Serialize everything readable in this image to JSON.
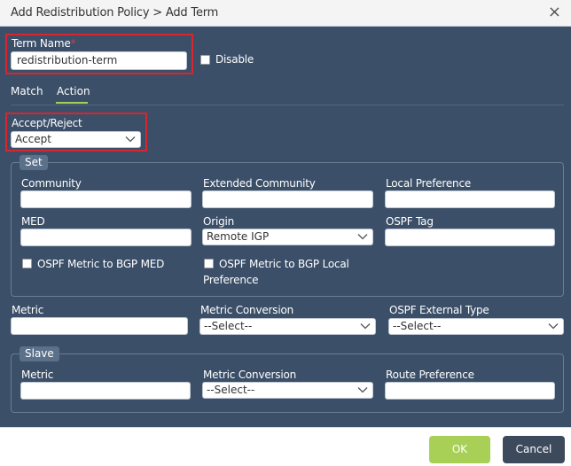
{
  "dialog": {
    "title": "Add Redistribution Policy > Add Term",
    "close_glyph": "×"
  },
  "term": {
    "name_label": "Term Name",
    "required_mark": "*",
    "name_value": "redistribution-term",
    "disable_label": "Disable"
  },
  "tabs": [
    {
      "label": "Match",
      "active": false
    },
    {
      "label": "Action",
      "active": true
    }
  ],
  "action": {
    "accept_reject_label": "Accept/Reject",
    "accept_reject_value": "Accept"
  },
  "set": {
    "legend": "Set",
    "community_label": "Community",
    "community_value": "",
    "extended_community_label": "Extended Community",
    "extended_community_value": "",
    "local_preference_label": "Local Preference",
    "local_preference_value": "",
    "med_label": "MED",
    "med_value": "",
    "origin_label": "Origin",
    "origin_value": "Remote IGP",
    "ospf_tag_label": "OSPF Tag",
    "ospf_tag_value": "",
    "ospf_metric_to_bgp_med_label": "OSPF Metric to BGP MED",
    "ospf_metric_to_bgp_local_pref_line1": "OSPF Metric to BGP Local",
    "ospf_metric_to_bgp_local_pref_line2": "Preference"
  },
  "metric": {
    "metric_label": "Metric",
    "metric_value": "",
    "metric_conversion_label": "Metric Conversion",
    "metric_conversion_value": "--Select--",
    "ospf_external_type_label": "OSPF External Type",
    "ospf_external_type_value": "--Select--"
  },
  "slave": {
    "legend": "Slave",
    "metric_label": "Metric",
    "metric_value": "",
    "metric_conversion_label": "Metric Conversion",
    "metric_conversion_value": "--Select--",
    "route_preference_label": "Route Preference",
    "route_preference_value": ""
  },
  "footer": {
    "ok_label": "OK",
    "cancel_label": "Cancel"
  },
  "colors": {
    "panel_bg": "#3b4f68",
    "accent_green": "#a8cf56",
    "cancel_bg": "#3c4a5c",
    "highlight_red": "#d9262e",
    "required_red": "#e23b3b"
  },
  "icons": {
    "close": "close-icon",
    "dropdown": "chevron-down-icon"
  }
}
